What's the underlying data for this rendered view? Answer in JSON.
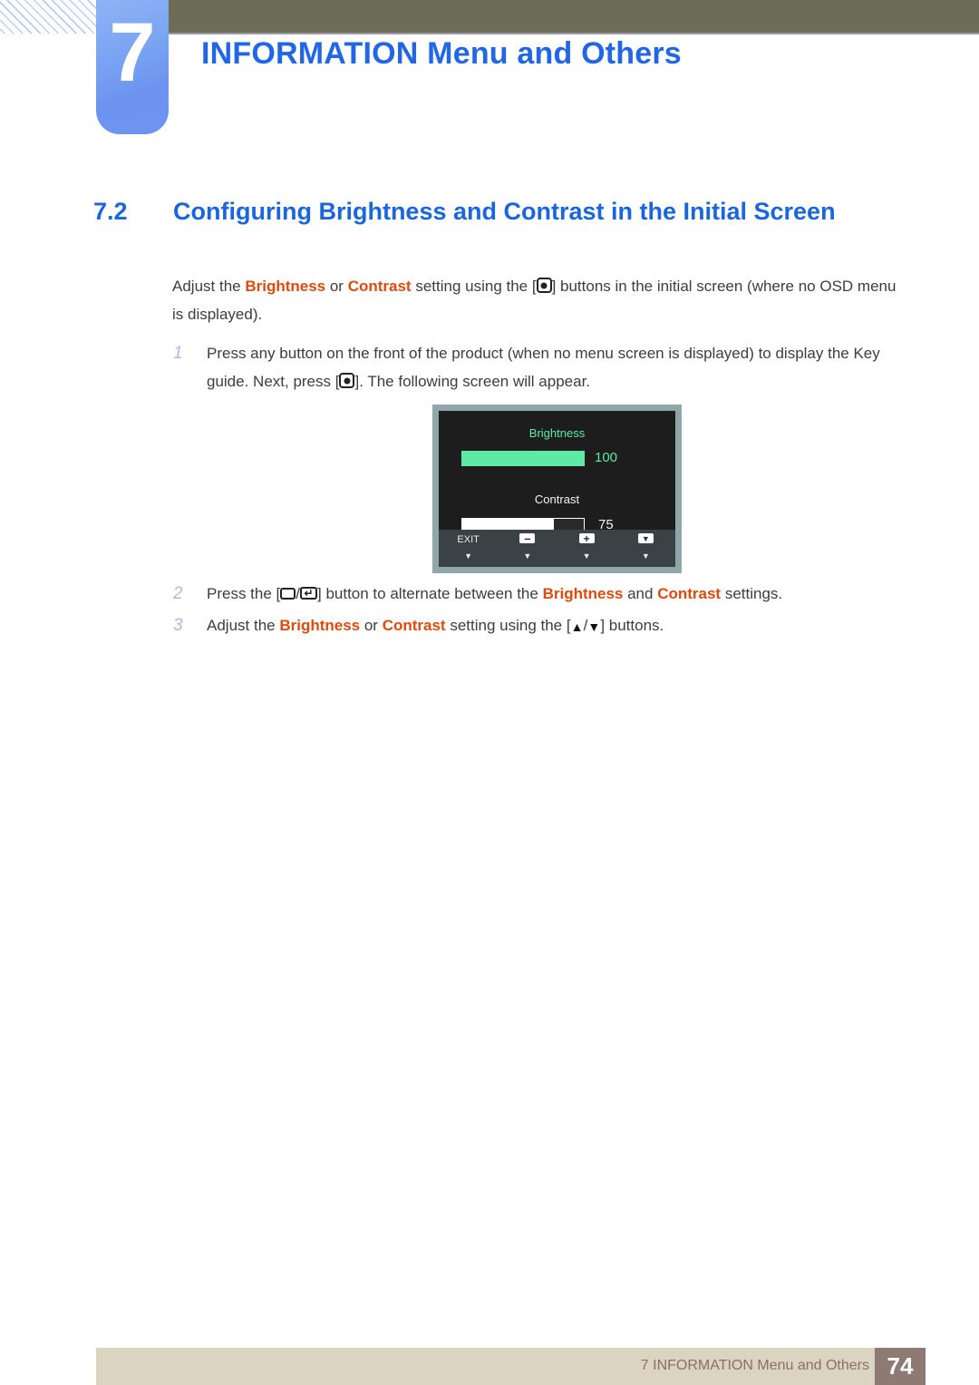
{
  "header": {
    "chapter_number": "7",
    "chapter_title": "INFORMATION Menu and Others",
    "olive_bar_color": "#6d6c56",
    "tab_color": "#7aa5f2",
    "title_color": "#2266e8"
  },
  "section": {
    "number": "7.2",
    "title": "Configuring Brightness and Contrast in the Initial Screen",
    "color": "#1a66e0"
  },
  "intro": {
    "part1": "Adjust the ",
    "kw_brightness": "Brightness",
    "part2": " or ",
    "kw_contrast": "Contrast",
    "part3": " setting using the [",
    "part4": "] buttons in the initial screen (where no OSD menu is displayed).",
    "keyword_color": "#e2490d"
  },
  "steps": [
    {
      "number": "1",
      "text_a": "Press any button on the front of the product (when no menu screen is displayed) to display the Key guide. Next, press [",
      "text_b": "]. The following screen will appear."
    },
    {
      "number": "2",
      "text_a": "Press the [",
      "sep": "/",
      "text_b": "] button to alternate between the ",
      "kw1": "Brightness",
      "text_c": " and ",
      "kw2": "Contrast",
      "text_d": " settings."
    },
    {
      "number": "3",
      "text_a": "Adjust the ",
      "kw1": "Brightness",
      "text_b": " or ",
      "kw2": "Contrast",
      "text_c": " setting using the [",
      "sep": "/",
      "text_d": "] buttons."
    }
  ],
  "osd": {
    "brightness_label": "Brightness",
    "brightness_value": "100",
    "brightness_percent": 100,
    "brightness_color": "#5fe9a6",
    "contrast_label": "Contrast",
    "contrast_value": "75",
    "contrast_percent": 75,
    "contrast_color": "#ffffff",
    "screen_color": "#1d1d1d",
    "bezel_color": "#8fa7a8",
    "keyguide": [
      {
        "label": "EXIT",
        "icon": "none",
        "caret": "▼"
      },
      {
        "label": "",
        "icon": "minus-button-icon",
        "caret": "▼"
      },
      {
        "label": "",
        "icon": "plus-button-icon",
        "caret": "▼"
      },
      {
        "label": "",
        "icon": "down-button-icon",
        "caret": "▼"
      }
    ]
  },
  "footer": {
    "text": "7 INFORMATION Menu and Others",
    "page_number": "74",
    "bar_color": "#dad4c0",
    "page_box_color": "#8d7a72",
    "text_color": "#8b6f6a"
  }
}
